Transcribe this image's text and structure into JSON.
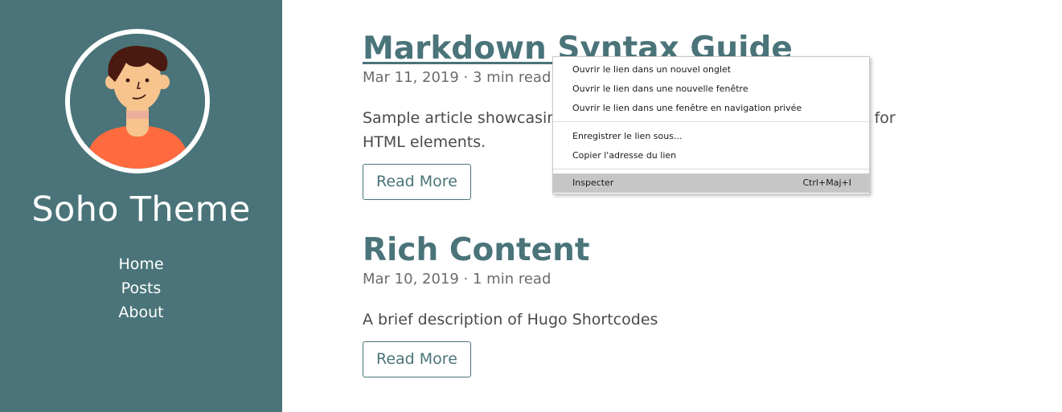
{
  "sidebar": {
    "title": "Soho Theme",
    "nav": [
      "Home",
      "Posts",
      "About"
    ]
  },
  "posts": [
    {
      "title": "Markdown Syntax Guide",
      "meta": "Mar 11, 2019 · 3 min read",
      "summary": "Sample article showcasing basic Markdown syntax and formatting for HTML elements.",
      "read_more": "Read More"
    },
    {
      "title": "Rich Content",
      "meta": "Mar 10, 2019 · 1 min read",
      "summary": "A brief description of Hugo Shortcodes",
      "read_more": "Read More"
    }
  ],
  "context_menu": {
    "items": [
      "Ouvrir le lien dans un nouvel onglet",
      "Ouvrir le lien dans une nouvelle fenêtre",
      "Ouvrir le lien dans une fenêtre en navigation privée",
      "Enregistrer le lien sous...",
      "Copier l'adresse du lien",
      "Inspecter"
    ],
    "inspect_shortcut": "Ctrl+Maj+I"
  },
  "colors": {
    "sidebar_bg": "#4a7479",
    "accent": "#4a7479",
    "shirt": "#ff6b3f",
    "skin": "#f7c48e",
    "hair": "#4a1a10"
  }
}
